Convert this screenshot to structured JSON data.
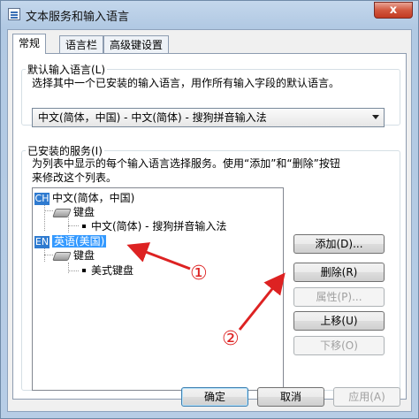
{
  "window": {
    "title": "文本服务和输入语言",
    "close_label": "x"
  },
  "tabs": [
    {
      "label": "常规"
    },
    {
      "label": "语言栏"
    },
    {
      "label": "高级键设置"
    }
  ],
  "default_lang": {
    "legend": "默认输入语言(L)",
    "description": "选择其中一个已安装的输入语言，用作所有输入字段的默认语言。",
    "selected": "中文(简体，中国) - 中文(简体) - 搜狗拼音输入法"
  },
  "services": {
    "legend": "已安装的服务(I)",
    "description_line1": "为列表中显示的每个输入语言选择服务。使用“添加”和“删除”按钮",
    "description_line2": "来修改这个列表。",
    "tree": {
      "lang1": {
        "badge": "CH",
        "label": "中文(简体，中国)"
      },
      "lang1_group": "键盘",
      "lang1_item": "中文(简体) - 搜狗拼音输入法",
      "lang2": {
        "badge": "EN",
        "label": "英语(美国)"
      },
      "lang2_group": "键盘",
      "lang2_item": "美式键盘"
    },
    "buttons": {
      "add": "添加(D)...",
      "remove": "删除(R)",
      "properties": "属性(P)...",
      "move_up": "上移(U)",
      "move_down": "下移(O)"
    }
  },
  "footer": {
    "ok": "确定",
    "cancel": "取消",
    "apply": "应用(A)"
  },
  "annotations": {
    "one": "①",
    "two": "②"
  },
  "colors": {
    "accent": "#3399ff",
    "annotation": "#dd2222"
  }
}
